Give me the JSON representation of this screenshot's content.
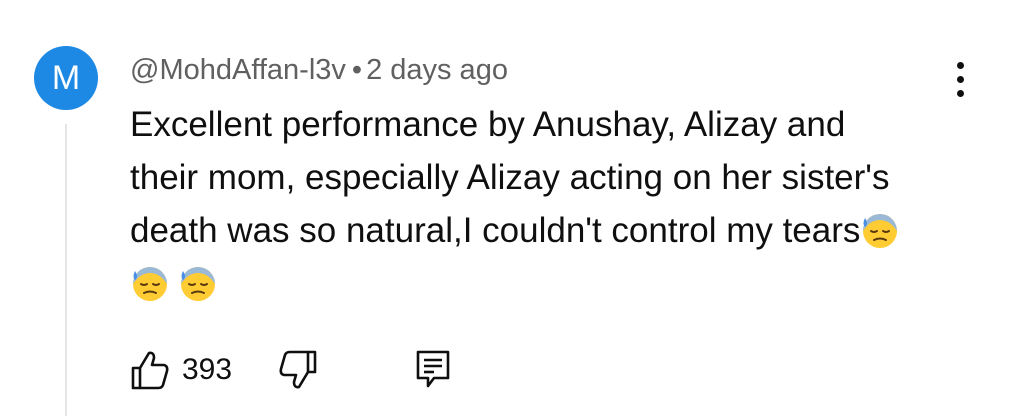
{
  "comment": {
    "avatar_letter": "M",
    "avatar_color": "#1e88e5",
    "author": "@MohdAffan-l3v",
    "separator": "•",
    "timestamp": "2 days ago",
    "lines": [
      "Excellent performance by Anushay, Alizay and",
      "their mom, especially Alizay acting on her sister's",
      "death was so natural,I couldn't control my tears"
    ],
    "emoji_name": "downcast-face-with-sweat",
    "like_count": "393"
  },
  "icons": {
    "menu": "more-vert-icon",
    "like": "thumbs-up-icon",
    "dislike": "thumbs-down-icon",
    "reply": "reply-comment-icon"
  }
}
